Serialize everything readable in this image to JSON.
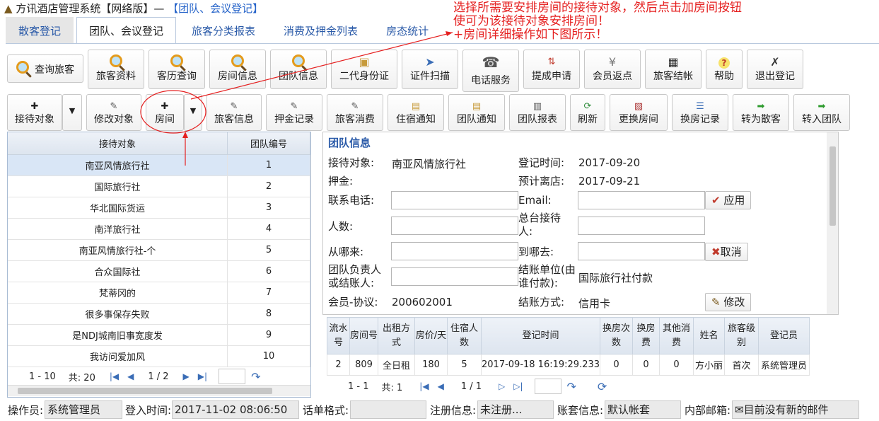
{
  "app": {
    "title_prefix": "方讯酒店管理系统【网络版】—",
    "title_sub": "【团队、会议登记】"
  },
  "tabs": [
    "散客登记",
    "团队、会议登记",
    "旅客分类报表",
    "消费及押金列表",
    "房态统计"
  ],
  "toolbar1": [
    {
      "label": "查询旅客",
      "icon": "search-icon"
    },
    {
      "label": "旅客资料",
      "icon": "search-icon"
    },
    {
      "label": "客历查询",
      "icon": "search-icon"
    },
    {
      "label": "房间信息",
      "icon": "search-icon"
    },
    {
      "label": "团队信息",
      "icon": "search-icon"
    },
    {
      "label": "二代身份证",
      "icon": "id-card-icon"
    },
    {
      "label": "证件扫描",
      "icon": "scanner-icon"
    },
    {
      "label": "电话服务",
      "icon": "phone-icon"
    },
    {
      "label": "提成申请",
      "icon": "sort-icon"
    },
    {
      "label": "会员返点",
      "icon": "yen-icon"
    },
    {
      "label": "旅客结帐",
      "icon": "calculator-icon"
    },
    {
      "label": "帮助",
      "icon": "help-icon"
    },
    {
      "label": "退出登记",
      "icon": "close-icon"
    }
  ],
  "toolbar2": [
    {
      "label": "接待对象",
      "icon": "plus-icon"
    },
    {
      "label": "修改对象",
      "icon": "edit-icon"
    },
    {
      "label": "房间",
      "icon": "plus-icon"
    },
    {
      "label": "旅客信息",
      "icon": "edit-icon"
    },
    {
      "label": "押金记录",
      "icon": "edit-icon"
    },
    {
      "label": "旅客消费",
      "icon": "edit-icon"
    },
    {
      "label": "住宿通知",
      "icon": "document-icon"
    },
    {
      "label": "团队通知",
      "icon": "document-icon"
    },
    {
      "label": "团队报表",
      "icon": "report-icon"
    },
    {
      "label": "刷新",
      "icon": "refresh-icon"
    },
    {
      "label": "更换房间",
      "icon": "swap-icon"
    },
    {
      "label": "换房记录",
      "icon": "list-icon"
    },
    {
      "label": "转为散客",
      "icon": "arrow-right-icon"
    },
    {
      "label": "转入团队",
      "icon": "arrow-right-icon"
    }
  ],
  "left_table": {
    "headers": [
      "接待对象",
      "团队编号"
    ],
    "rows": [
      [
        "南亚风情旅行社",
        "1"
      ],
      [
        "国际旅行社",
        "2"
      ],
      [
        "华北国际货运",
        "3"
      ],
      [
        "南洋旅行社",
        "4"
      ],
      [
        "南亚风情旅行社-个",
        "5"
      ],
      [
        "合众国际社",
        "6"
      ],
      [
        "梵蒂冈的",
        "7"
      ],
      [
        "很多事保存失败",
        "8"
      ],
      [
        "是NDJ城南旧事宽度发",
        "9"
      ],
      [
        "我访问爱加风",
        "10"
      ]
    ],
    "pager": {
      "range": "1 - 10",
      "total": "共: 20",
      "page": "1 / 2"
    }
  },
  "team_info": {
    "title": "团队信息",
    "labels": {
      "reception": "接待对象:",
      "deposit": "押金:",
      "phone": "联系电话:",
      "people": "人数:",
      "from": "从哪来:",
      "leader": "团队负责人或结账人:",
      "member": "会员-协议:",
      "reg_time": "登记时间:",
      "leave": "预计离店:",
      "email": "Email:",
      "desk": "总台接待人:",
      "to": "到哪去:",
      "pay_unit": "结账单位(由谁付款):",
      "pay_method": "结账方式:"
    },
    "values": {
      "reception": "南亚风情旅行社",
      "member": "200602001",
      "reg_time": "2017-09-20",
      "leave": "2017-09-21",
      "pay_unit": "国际旅行社付款",
      "pay_method": "信用卡"
    },
    "buttons": {
      "apply": "应用",
      "cancel": "取消",
      "modify": "修改"
    }
  },
  "room_table": {
    "headers": [
      "流水号",
      "房间号",
      "出租方式",
      "房价/天",
      "住宿人数",
      "登记时间",
      "换房次数",
      "换房费",
      "其他消费",
      "姓名",
      "旅客级别",
      "登记员"
    ],
    "rows": [
      [
        "2",
        "809",
        "全日租",
        "180",
        "5",
        "2017-09-18 16:19:29.233",
        "0",
        "0",
        "0",
        "方小丽",
        "首次",
        "系统管理员"
      ]
    ],
    "pager": {
      "range": "1 - 1",
      "total": "共: 1",
      "page": "1 / 1"
    }
  },
  "status": {
    "operator_label": "操作员:",
    "operator": "系统管理员",
    "login_label": "登入时间:",
    "login": "2017-11-02 08:06:50",
    "format_label": "话单格式:",
    "format": "",
    "reg_label": "注册信息:",
    "reg": "未注册...",
    "account_label": "账套信息:",
    "account": "默认帐套",
    "mail_label": "内部邮箱:",
    "mail": "目前没有新的邮件"
  },
  "annotation": {
    "line1": "选择所需要安排房间的接待对象，然后点击加房间按钮",
    "line2": "使可为该接待对象安排房间！",
    "line3": "+房间详细操作如下图所示！"
  },
  "colors": {
    "accent": "#2a5aa8",
    "annotation": "#e52020",
    "selected_row": "#d9e6f6"
  }
}
